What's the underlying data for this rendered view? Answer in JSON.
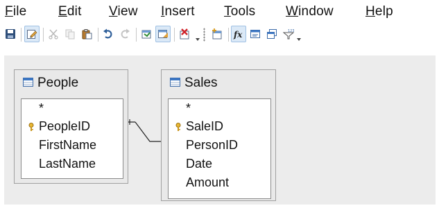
{
  "menubar": {
    "items": [
      {
        "label": "File",
        "mnemonic": "F",
        "rest": "ile"
      },
      {
        "label": "Edit",
        "mnemonic": "E",
        "rest": "dit"
      },
      {
        "label": "View",
        "mnemonic": "V",
        "rest": "iew"
      },
      {
        "label": "Insert",
        "mnemonic": "I",
        "rest": "nsert"
      },
      {
        "label": "Tools",
        "mnemonic": "T",
        "rest": "ools"
      },
      {
        "label": "Window",
        "mnemonic": "W",
        "rest": "indow"
      },
      {
        "label": "Help",
        "mnemonic": "H",
        "rest": "elp"
      }
    ]
  },
  "toolbar": {
    "buttons": [
      {
        "name": "save-icon"
      },
      {
        "name": "edit-mode-icon",
        "active": true
      },
      {
        "name": "cut-icon",
        "disabled": true
      },
      {
        "name": "copy-icon",
        "disabled": true
      },
      {
        "name": "paste-icon"
      },
      {
        "name": "undo-icon"
      },
      {
        "name": "redo-icon",
        "disabled": true
      },
      {
        "name": "run-query-icon"
      },
      {
        "name": "design-view-icon",
        "active": true
      },
      {
        "name": "clear-query-icon"
      },
      {
        "name": "add-tables-icon"
      },
      {
        "name": "functions-icon",
        "active": true
      },
      {
        "name": "table-name-icon"
      },
      {
        "name": "alias-icon"
      },
      {
        "name": "distinct-values-icon"
      }
    ]
  },
  "colors": {
    "canvas": "#ececec",
    "window": "#e9e9e9",
    "accent": "#3b76c4",
    "key": "#d9a21b"
  },
  "tables": {
    "people": {
      "title": "People",
      "fields": [
        {
          "label": "*",
          "key": false
        },
        {
          "label": "PeopleID",
          "key": true
        },
        {
          "label": "FirstName",
          "key": false
        },
        {
          "label": "LastName",
          "key": false
        }
      ]
    },
    "sales": {
      "title": "Sales",
      "fields": [
        {
          "label": "*",
          "key": false
        },
        {
          "label": "SaleID",
          "key": true
        },
        {
          "label": "PersonID",
          "key": false
        },
        {
          "label": "Date",
          "key": false
        },
        {
          "label": "Amount",
          "key": false
        }
      ]
    }
  },
  "relation": {
    "from": "People.PeopleID",
    "to": "Sales.PersonID"
  }
}
